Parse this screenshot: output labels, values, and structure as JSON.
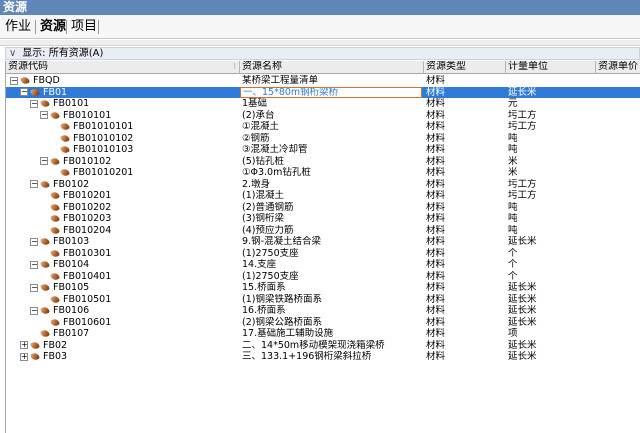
{
  "window": {
    "title": "资源"
  },
  "tabs": [
    {
      "label": "作业",
      "active": false
    },
    {
      "label": "资源",
      "active": true
    },
    {
      "label": "项目",
      "active": false
    }
  ],
  "filter": {
    "label": "显示: 所有资源(A)"
  },
  "columns": {
    "code": "资源代码",
    "name": "资源名称",
    "type": "资源类型",
    "unit": "计量单位",
    "price": "资源单价"
  },
  "rows": [
    {
      "code": "FBQD",
      "name": "某桥梁工程量清单",
      "type": "材料",
      "unit": "",
      "level": 0,
      "toggle": "-"
    },
    {
      "code": "FB01",
      "name": "一、15*80m钢桁梁桥",
      "type": "材料",
      "unit": "延长米",
      "level": 1,
      "toggle": "-",
      "selected": true
    },
    {
      "code": "FB0101",
      "name": "1基础",
      "type": "材料",
      "unit": "元",
      "level": 2,
      "toggle": "-"
    },
    {
      "code": "FB010101",
      "name": "(2)承台",
      "type": "材料",
      "unit": "圬工方",
      "level": 3,
      "toggle": "-"
    },
    {
      "code": "FB01010101",
      "name": "①混凝土",
      "type": "材料",
      "unit": "圬工方",
      "level": 4,
      "toggle": ""
    },
    {
      "code": "FB01010102",
      "name": "②钢筋",
      "type": "材料",
      "unit": "吨",
      "level": 4,
      "toggle": ""
    },
    {
      "code": "FB01010103",
      "name": "③混凝土冷却管",
      "type": "材料",
      "unit": "吨",
      "level": 4,
      "toggle": ""
    },
    {
      "code": "FB010102",
      "name": "(5)钻孔桩",
      "type": "材料",
      "unit": "米",
      "level": 3,
      "toggle": "-"
    },
    {
      "code": "FB01010201",
      "name": "①Φ3.0m钻孔桩",
      "type": "材料",
      "unit": "米",
      "level": 4,
      "toggle": ""
    },
    {
      "code": "FB0102",
      "name": "2.墩身",
      "type": "材料",
      "unit": "圬工方",
      "level": 2,
      "toggle": "-"
    },
    {
      "code": "FB010201",
      "name": "(1)混凝土",
      "type": "材料",
      "unit": "圬工方",
      "level": 3,
      "toggle": ""
    },
    {
      "code": "FB010202",
      "name": "(2)普通钢筋",
      "type": "材料",
      "unit": "吨",
      "level": 3,
      "toggle": ""
    },
    {
      "code": "FB010203",
      "name": "(3)钢桁梁",
      "type": "材料",
      "unit": "吨",
      "level": 3,
      "toggle": ""
    },
    {
      "code": "FB010204",
      "name": "(4)预应力筋",
      "type": "材料",
      "unit": "吨",
      "level": 3,
      "toggle": ""
    },
    {
      "code": "FB0103",
      "name": "9.钢-混凝土结合梁",
      "type": "材料",
      "unit": "延长米",
      "level": 2,
      "toggle": "-"
    },
    {
      "code": "FB010301",
      "name": "(1)2750支座",
      "type": "材料",
      "unit": "个",
      "level": 3,
      "toggle": ""
    },
    {
      "code": "FB0104",
      "name": "14.支座",
      "type": "材料",
      "unit": "个",
      "level": 2,
      "toggle": "-"
    },
    {
      "code": "FB010401",
      "name": "(1)2750支座",
      "type": "材料",
      "unit": "个",
      "level": 3,
      "toggle": ""
    },
    {
      "code": "FB0105",
      "name": "15.桥面系",
      "type": "材料",
      "unit": "延长米",
      "level": 2,
      "toggle": "-"
    },
    {
      "code": "FB010501",
      "name": "(1)钢梁铁路桥面系",
      "type": "材料",
      "unit": "延长米",
      "level": 3,
      "toggle": ""
    },
    {
      "code": "FB0106",
      "name": "16.桥面系",
      "type": "材料",
      "unit": "延长米",
      "level": 2,
      "toggle": "-"
    },
    {
      "code": "FB010601",
      "name": "(2)钢梁公路桥面系",
      "type": "材料",
      "unit": "延长米",
      "level": 3,
      "toggle": ""
    },
    {
      "code": "FB0107",
      "name": "17.基础施工辅助设施",
      "type": "材料",
      "unit": "项",
      "level": 2,
      "toggle": ""
    },
    {
      "code": "FB02",
      "name": "二、14*50m移动模架现浇箱梁桥",
      "type": "材料",
      "unit": "延长米",
      "level": 1,
      "toggle": "+"
    },
    {
      "code": "FB03",
      "name": "三、133.1+196钢桁梁斜拉桥",
      "type": "材料",
      "unit": "延长米",
      "level": 1,
      "toggle": "+"
    }
  ]
}
